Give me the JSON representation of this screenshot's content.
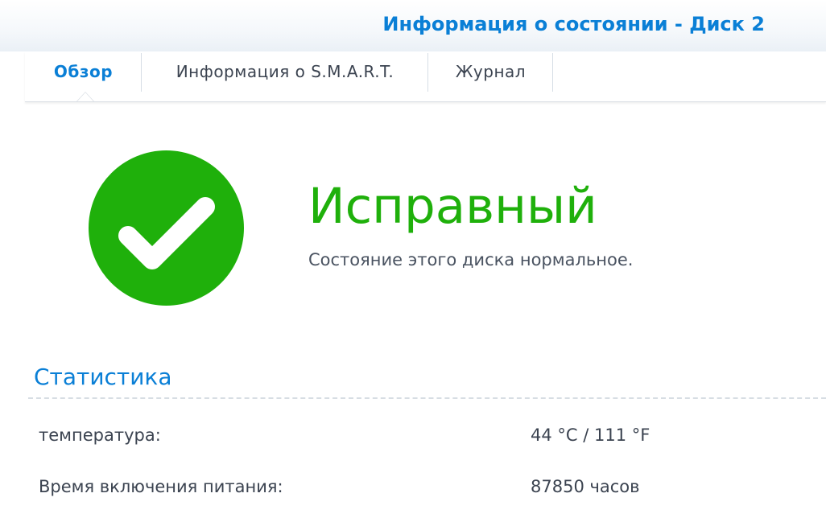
{
  "window": {
    "title": "Информация о состоянии - Диск 2"
  },
  "tabs": [
    {
      "label": "Обзор",
      "active": true
    },
    {
      "label": "Информация о S.M.A.R.T.",
      "active": false
    },
    {
      "label": "Журнал",
      "active": false
    }
  ],
  "status": {
    "icon": "checkmark-circle-icon",
    "color": "#1fb00b",
    "title": "Исправный",
    "description": "Состояние этого диска нормальное."
  },
  "statistics": {
    "title": "Статистика",
    "rows": [
      {
        "label": "температура:",
        "value": "44 °C / 111 °F"
      },
      {
        "label": "Время включения питания:",
        "value": "87850 часов"
      }
    ]
  },
  "colors": {
    "accent": "#0a7fd6",
    "healthy": "#1fb00b",
    "text": "#3b4350"
  }
}
